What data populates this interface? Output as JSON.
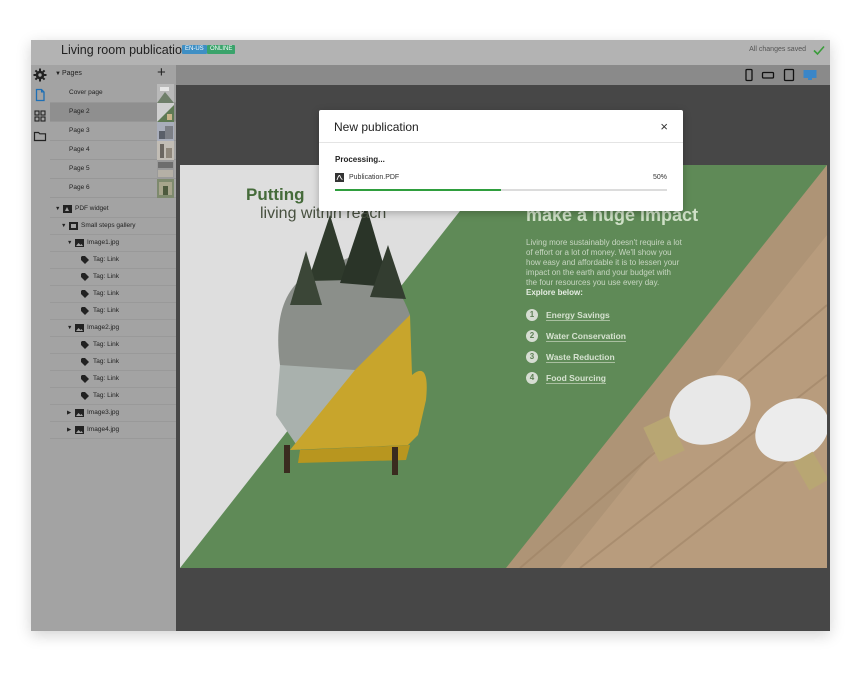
{
  "header": {
    "title": "Living room publication",
    "language_badge": "EN-US",
    "status_badge": "ONLINE",
    "save_status": "All changes saved"
  },
  "rail": {
    "icons": [
      "gear-icon",
      "document-icon",
      "grid-icon",
      "folder-icon"
    ]
  },
  "sidebar": {
    "pages_label": "Pages",
    "add_label": "+",
    "pages": [
      {
        "label": "Cover page"
      },
      {
        "label": "Page 2",
        "selected": true
      },
      {
        "label": "Page 3"
      },
      {
        "label": "Page 4"
      },
      {
        "label": "Page 5"
      },
      {
        "label": "Page 6"
      }
    ],
    "tree": [
      {
        "label": "PDF widget"
      },
      {
        "label": "Small steps gallery"
      },
      {
        "label": "Image1.jpg"
      },
      {
        "label": "Tag: Link"
      },
      {
        "label": "Tag: Link"
      },
      {
        "label": "Tag: Link"
      },
      {
        "label": "Tag: Link"
      },
      {
        "label": "Image2.jpg"
      },
      {
        "label": "Tag: Link"
      },
      {
        "label": "Tag: Link"
      },
      {
        "label": "Tag: Link"
      },
      {
        "label": "Tag: Link"
      },
      {
        "label": "Image3.jpg"
      },
      {
        "label": "Image4.jpg"
      }
    ]
  },
  "device_toolbar": {
    "devices": [
      "phone-portrait-icon",
      "phone-landscape-icon",
      "tablet-icon",
      "desktop-icon"
    ],
    "active": "desktop-icon"
  },
  "canvas": {
    "heading_left_1": "Putting",
    "heading_left_2": "living within reach",
    "heading_right": "make a huge impact",
    "body_text": "Living more sustainably doesn't require a lot of effort or a lot of money. We'll show you how easy and affordable it is to lessen your impact on the earth and your budget with the four resources you use every day.",
    "body_cta": "Explore below:",
    "list": [
      {
        "num": "1",
        "label": "Energy Savings"
      },
      {
        "num": "2",
        "label": "Water Conservation"
      },
      {
        "num": "3",
        "label": "Waste Reduction"
      },
      {
        "num": "4",
        "label": "Food Sourcing"
      }
    ]
  },
  "modal": {
    "title": "New publication",
    "close_label": "×",
    "processing_label": "Processing...",
    "file_name": "Publication.PDF",
    "progress_label": "50%",
    "progress": 0.5
  },
  "colors": {
    "accent_green": "#2f9e3e",
    "language_badge": "#3f8fc4",
    "status_badge": "#3aa36b",
    "active_device": "#3a86c8"
  }
}
